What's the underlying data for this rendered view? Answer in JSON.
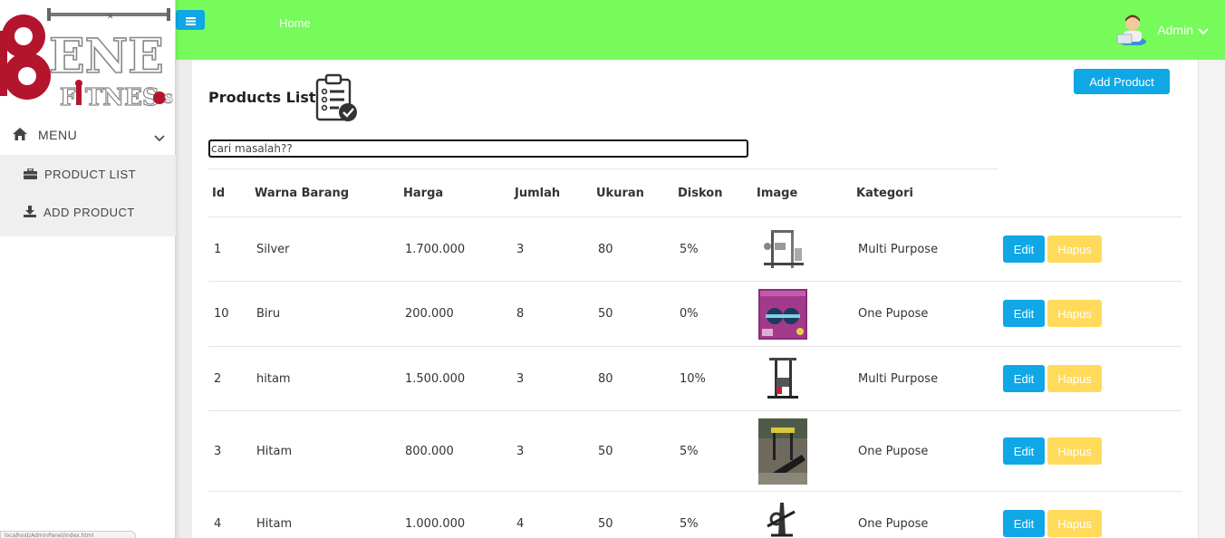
{
  "brand": {
    "logo_text": "BENE FITNESS",
    "accent_color": "#76fb5b",
    "primary_color": "#10a7e6",
    "warning_color": "#ffda5b"
  },
  "topbar": {
    "menu_toggle_icon": "hamburger-icon",
    "home_label": "Home",
    "user_name": "Admin"
  },
  "sidebar": {
    "menu_label": "MENU",
    "items": [
      {
        "label": "PRODUCT LIST",
        "icon": "briefcase-icon"
      },
      {
        "label": "ADD PRODUCT",
        "icon": "download-icon"
      }
    ],
    "status_text": "localhost/AdminPanel/index.html"
  },
  "page": {
    "title": "Products List",
    "add_button": "Add Product",
    "search_placeholder": "cari masalah??"
  },
  "table": {
    "headers": [
      "Id",
      "Warna Barang",
      "Harga",
      "Jumlah",
      "Ukuran",
      "Diskon",
      "Image",
      "Kategori"
    ],
    "edit_label": "Edit",
    "delete_label": "Hapus",
    "rows": [
      {
        "id": "1",
        "warna": "Silver",
        "harga": "1.700.000",
        "jumlah": "3",
        "ukuran": "80",
        "diskon": "5%",
        "image": "home-gym-machine",
        "kategori": "Multi Purpose"
      },
      {
        "id": "10",
        "warna": "Biru",
        "harga": "200.000",
        "jumlah": "8",
        "ukuran": "50",
        "diskon": "0%",
        "image": "ab-roller-box",
        "kategori": "One Pupose"
      },
      {
        "id": "2",
        "warna": "hitam",
        "harga": "1.500.000",
        "jumlah": "3",
        "ukuran": "80",
        "diskon": "10%",
        "image": "home-gym-station",
        "kategori": "Multi Purpose"
      },
      {
        "id": "3",
        "warna": "Hitam",
        "harga": "800.000",
        "jumlah": "3",
        "ukuran": "50",
        "diskon": "5%",
        "image": "treadmill",
        "kategori": "One Pupose"
      },
      {
        "id": "4",
        "warna": "Hitam",
        "harga": "1.000.000",
        "jumlah": "4",
        "ukuran": "50",
        "diskon": "5%",
        "image": "elliptical-trainer",
        "kategori": "One Pupose"
      }
    ]
  }
}
